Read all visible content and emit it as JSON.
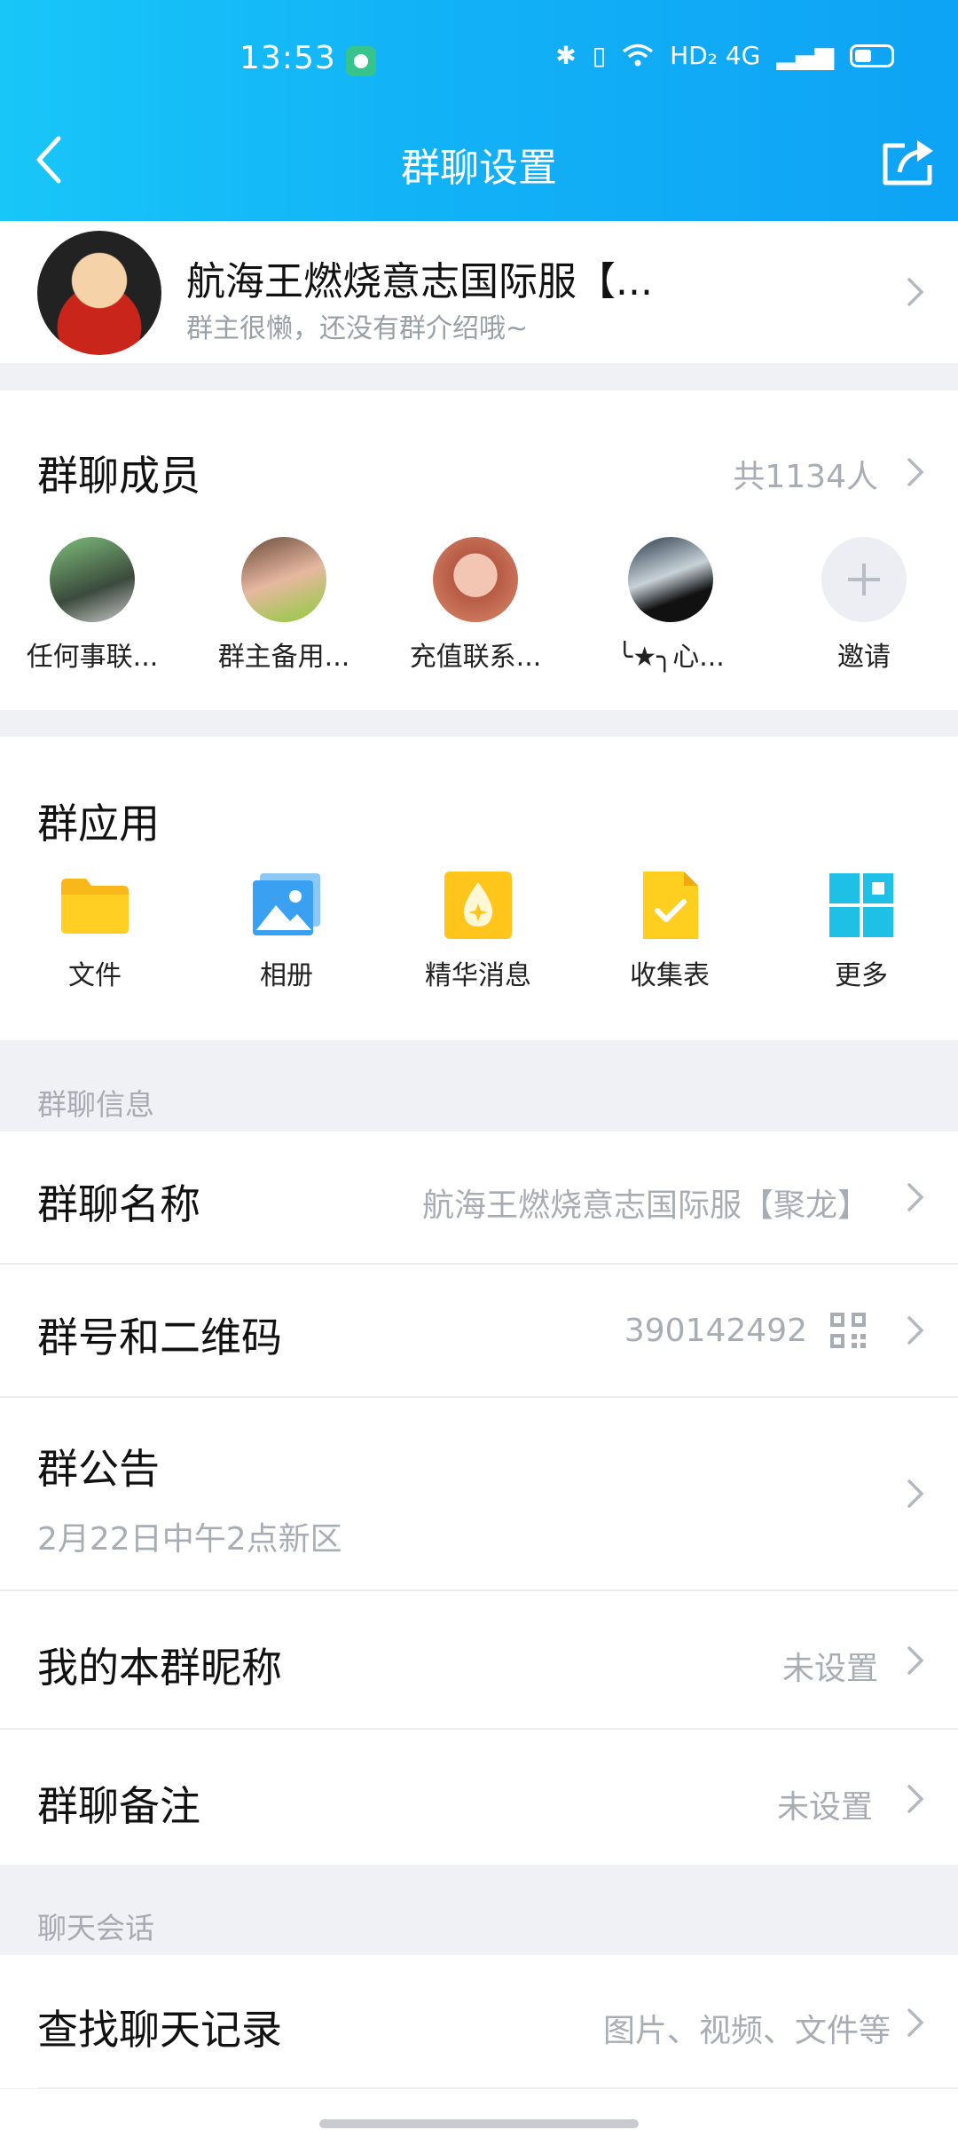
{
  "status_bar": {
    "time": "13:53",
    "network": "HD₂  4G"
  },
  "nav": {
    "title": "群聊设置"
  },
  "group": {
    "name": "航海王燃烧意志国际服【...",
    "description": "群主很懒，还没有群介绍哦~"
  },
  "members": {
    "title": "群聊成员",
    "count": "共1134人",
    "list": [
      {
        "name": "任何事联..."
      },
      {
        "name": "群主备用..."
      },
      {
        "name": "充值联系..."
      },
      {
        "name": "╰★╮心..."
      }
    ],
    "invite_label": "邀请"
  },
  "apps": {
    "title": "群应用",
    "items": [
      {
        "label": "文件",
        "icon": "folder-icon"
      },
      {
        "label": "相册",
        "icon": "album-icon"
      },
      {
        "label": "精华消息",
        "icon": "essence-icon"
      },
      {
        "label": "收集表",
        "icon": "form-icon"
      },
      {
        "label": "更多",
        "icon": "more-grid-icon"
      }
    ]
  },
  "group_info": {
    "section_label": "群聊信息",
    "name_row": {
      "label": "群聊名称",
      "value": "航海王燃烧意志国际服【聚龙】"
    },
    "number_row": {
      "label": "群号和二维码",
      "value": "390142492"
    },
    "notice_row": {
      "label": "群公告",
      "value": "2月22日中午2点新区"
    },
    "nickname_row": {
      "label": "我的本群昵称",
      "value": "未设置"
    },
    "remark_row": {
      "label": "群聊备注",
      "value": "未设置"
    }
  },
  "chat_session": {
    "section_label": "聊天会话",
    "search_row": {
      "label": "查找聊天记录",
      "value": "图片、视频、文件等"
    }
  },
  "colors": {
    "header_start": "#18c6f8",
    "header_end": "#0ea3f5",
    "secondary_text": "#a8adb5"
  }
}
